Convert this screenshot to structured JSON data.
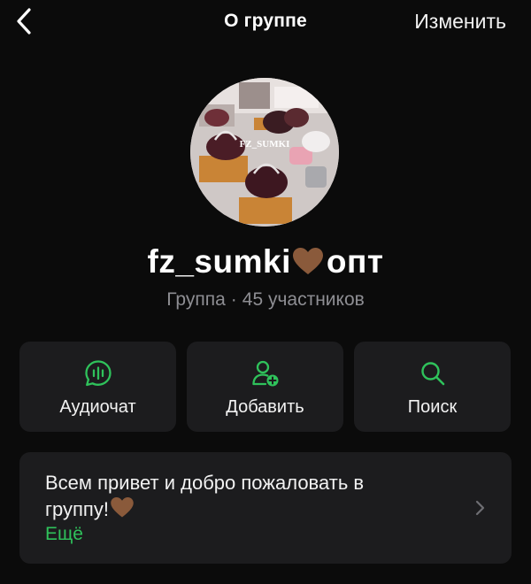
{
  "header": {
    "title": "О группе",
    "edit_label": "Изменить"
  },
  "avatar": {
    "watermark": "FZ_SUMKI"
  },
  "group": {
    "name_prefix": "fz_sumki",
    "name_suffix": "опт",
    "type": "Группа",
    "separator": "·",
    "members": "45 участников"
  },
  "actions": [
    {
      "label": "Аудиочат",
      "icon": "audio-chat-icon"
    },
    {
      "label": "Добавить",
      "icon": "add-user-icon"
    },
    {
      "label": "Поиск",
      "icon": "search-icon"
    }
  ],
  "description": {
    "line1": "Всем привет и добро пожаловать в",
    "line2": "группу!",
    "more_label": "Ещё"
  },
  "colors": {
    "accent": "#2fc25b",
    "background": "#0b0b0b",
    "card": "#1c1c1e",
    "secondary_text": "#8e8e93",
    "heart": "#8a5a3b"
  }
}
